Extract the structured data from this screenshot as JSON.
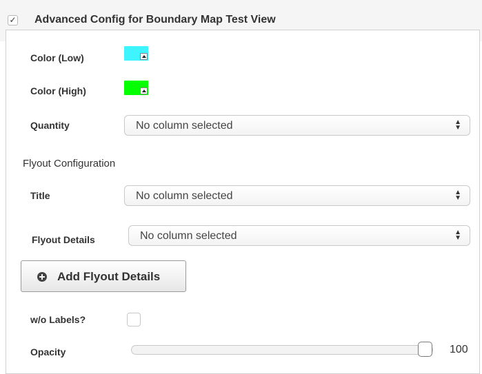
{
  "header": {
    "checkmark": "✓",
    "title": "Advanced Config for Boundary Map Test View",
    "checked": true
  },
  "fields": {
    "color_low_label": "Color (Low)",
    "color_low_value": "#3ef5ff",
    "color_high_label": "Color (High)",
    "color_high_value": "#04ff00",
    "quantity_label": "Quantity",
    "quantity_value": "No column selected"
  },
  "flyout": {
    "section_title": "Flyout Configuration",
    "title_label": "Title",
    "title_value": "No column selected",
    "details_label": "Flyout Details",
    "details_value": "No column selected",
    "add_button_label": "Add Flyout Details"
  },
  "options": {
    "wo_labels_label": "w/o Labels?",
    "wo_labels_checked": false,
    "opacity_label": "Opacity",
    "opacity_value": "100"
  },
  "icons": {
    "dropdown_arrow": "▲",
    "select_caret": "⬍",
    "add": "plus-circle"
  }
}
